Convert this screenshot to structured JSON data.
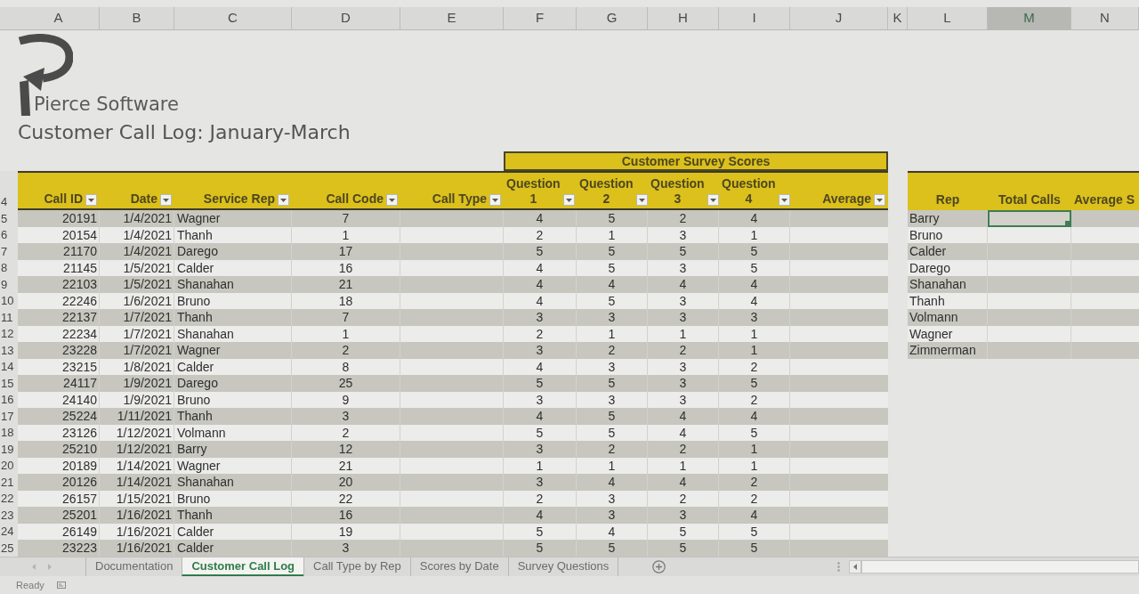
{
  "column_headers": [
    {
      "label": "A",
      "selected": false
    },
    {
      "label": "B",
      "selected": false
    },
    {
      "label": "C",
      "selected": false
    },
    {
      "label": "D",
      "selected": false
    },
    {
      "label": "E",
      "selected": false
    },
    {
      "label": "F",
      "selected": false
    },
    {
      "label": "G",
      "selected": false
    },
    {
      "label": "H",
      "selected": false
    },
    {
      "label": "I",
      "selected": false
    },
    {
      "label": "J",
      "selected": false
    },
    {
      "label": "K",
      "selected": false
    },
    {
      "label": "L",
      "selected": false
    },
    {
      "label": "M",
      "selected": true
    },
    {
      "label": "N",
      "selected": false
    }
  ],
  "row_numbers": [
    "4",
    "5",
    "6",
    "7",
    "8",
    "9",
    "10",
    "11",
    "12",
    "13",
    "14",
    "15",
    "16",
    "17",
    "18",
    "19",
    "20",
    "21",
    "22",
    "23",
    "24",
    "25"
  ],
  "logo": {
    "name": "Pierce Software"
  },
  "title": "Customer Call Log: January-March",
  "call_log": {
    "group_header": "Customer Survey Scores",
    "columns": [
      {
        "label": "Call ID",
        "filter": true
      },
      {
        "label": "Date",
        "filter": true
      },
      {
        "label": "Service Rep",
        "filter": true
      },
      {
        "label": "Call Code",
        "filter": true
      },
      {
        "label": "Call Type",
        "filter": true
      },
      {
        "label": "Question 1",
        "filter": true
      },
      {
        "label": "Question 2",
        "filter": true
      },
      {
        "label": "Question 3",
        "filter": true
      },
      {
        "label": "Question 4",
        "filter": true
      },
      {
        "label": "Average",
        "filter": true
      }
    ],
    "rows": [
      {
        "call_id": "20191",
        "date": "1/4/2021",
        "service_rep": "Wagner",
        "call_code": "7",
        "scores": [
          "4",
          "5",
          "2",
          "4"
        ]
      },
      {
        "call_id": "20154",
        "date": "1/4/2021",
        "service_rep": "Thanh",
        "call_code": "1",
        "scores": [
          "2",
          "1",
          "3",
          "1"
        ]
      },
      {
        "call_id": "21170",
        "date": "1/4/2021",
        "service_rep": "Darego",
        "call_code": "17",
        "scores": [
          "5",
          "5",
          "5",
          "5"
        ]
      },
      {
        "call_id": "21145",
        "date": "1/5/2021",
        "service_rep": "Calder",
        "call_code": "16",
        "scores": [
          "4",
          "5",
          "3",
          "5"
        ]
      },
      {
        "call_id": "22103",
        "date": "1/5/2021",
        "service_rep": "Shanahan",
        "call_code": "21",
        "scores": [
          "4",
          "4",
          "4",
          "4"
        ]
      },
      {
        "call_id": "22246",
        "date": "1/6/2021",
        "service_rep": "Bruno",
        "call_code": "18",
        "scores": [
          "4",
          "5",
          "3",
          "4"
        ]
      },
      {
        "call_id": "22137",
        "date": "1/7/2021",
        "service_rep": "Thanh",
        "call_code": "7",
        "scores": [
          "3",
          "3",
          "3",
          "3"
        ]
      },
      {
        "call_id": "22234",
        "date": "1/7/2021",
        "service_rep": "Shanahan",
        "call_code": "1",
        "scores": [
          "2",
          "1",
          "1",
          "1"
        ]
      },
      {
        "call_id": "23228",
        "date": "1/7/2021",
        "service_rep": "Wagner",
        "call_code": "2",
        "scores": [
          "3",
          "2",
          "2",
          "1"
        ]
      },
      {
        "call_id": "23215",
        "date": "1/8/2021",
        "service_rep": "Calder",
        "call_code": "8",
        "scores": [
          "4",
          "3",
          "3",
          "2"
        ]
      },
      {
        "call_id": "24117",
        "date": "1/9/2021",
        "service_rep": "Darego",
        "call_code": "25",
        "scores": [
          "5",
          "5",
          "3",
          "5"
        ]
      },
      {
        "call_id": "24140",
        "date": "1/9/2021",
        "service_rep": "Bruno",
        "call_code": "9",
        "scores": [
          "3",
          "3",
          "3",
          "2"
        ]
      },
      {
        "call_id": "25224",
        "date": "1/11/2021",
        "service_rep": "Thanh",
        "call_code": "3",
        "scores": [
          "4",
          "5",
          "4",
          "4"
        ]
      },
      {
        "call_id": "23126",
        "date": "1/12/2021",
        "service_rep": "Volmann",
        "call_code": "2",
        "scores": [
          "5",
          "5",
          "4",
          "5"
        ]
      },
      {
        "call_id": "25210",
        "date": "1/12/2021",
        "service_rep": "Barry",
        "call_code": "12",
        "scores": [
          "3",
          "2",
          "2",
          "1"
        ]
      },
      {
        "call_id": "20189",
        "date": "1/14/2021",
        "service_rep": "Wagner",
        "call_code": "21",
        "scores": [
          "1",
          "1",
          "1",
          "1"
        ]
      },
      {
        "call_id": "20126",
        "date": "1/14/2021",
        "service_rep": "Shanahan",
        "call_code": "20",
        "scores": [
          "3",
          "4",
          "4",
          "2"
        ]
      },
      {
        "call_id": "26157",
        "date": "1/15/2021",
        "service_rep": "Bruno",
        "call_code": "22",
        "scores": [
          "2",
          "3",
          "2",
          "2"
        ]
      },
      {
        "call_id": "25201",
        "date": "1/16/2021",
        "service_rep": "Thanh",
        "call_code": "16",
        "scores": [
          "4",
          "3",
          "3",
          "4"
        ]
      },
      {
        "call_id": "26149",
        "date": "1/16/2021",
        "service_rep": "Calder",
        "call_code": "19",
        "scores": [
          "5",
          "4",
          "5",
          "5"
        ]
      },
      {
        "call_id": "23223",
        "date": "1/16/2021",
        "service_rep": "Calder",
        "call_code": "3",
        "scores": [
          "5",
          "5",
          "5",
          "5"
        ]
      }
    ]
  },
  "rep_summary": {
    "columns": [
      {
        "label": "Rep"
      },
      {
        "label": "Total Calls"
      },
      {
        "label": "Average S"
      }
    ],
    "rows": [
      {
        "rep": "Barry",
        "total_calls_selected": true
      },
      {
        "rep": "Bruno",
        "total_calls_selected": false
      },
      {
        "rep": "Calder",
        "total_calls_selected": false
      },
      {
        "rep": "Darego",
        "total_calls_selected": false
      },
      {
        "rep": "Shanahan",
        "total_calls_selected": false
      },
      {
        "rep": "Thanh",
        "total_calls_selected": false
      },
      {
        "rep": "Volmann",
        "total_calls_selected": false
      },
      {
        "rep": "Wagner",
        "total_calls_selected": false
      },
      {
        "rep": "Zimmerman",
        "total_calls_selected": false
      }
    ]
  },
  "sheet_tabs": [
    {
      "label": "Documentation",
      "selected": false
    },
    {
      "label": "Customer Call Log",
      "selected": true
    },
    {
      "label": "Call Type by Rep",
      "selected": false
    },
    {
      "label": "Scores by Date",
      "selected": false
    },
    {
      "label": "Survey Questions",
      "selected": false
    }
  ],
  "status_bar": {
    "text": "Ready"
  }
}
